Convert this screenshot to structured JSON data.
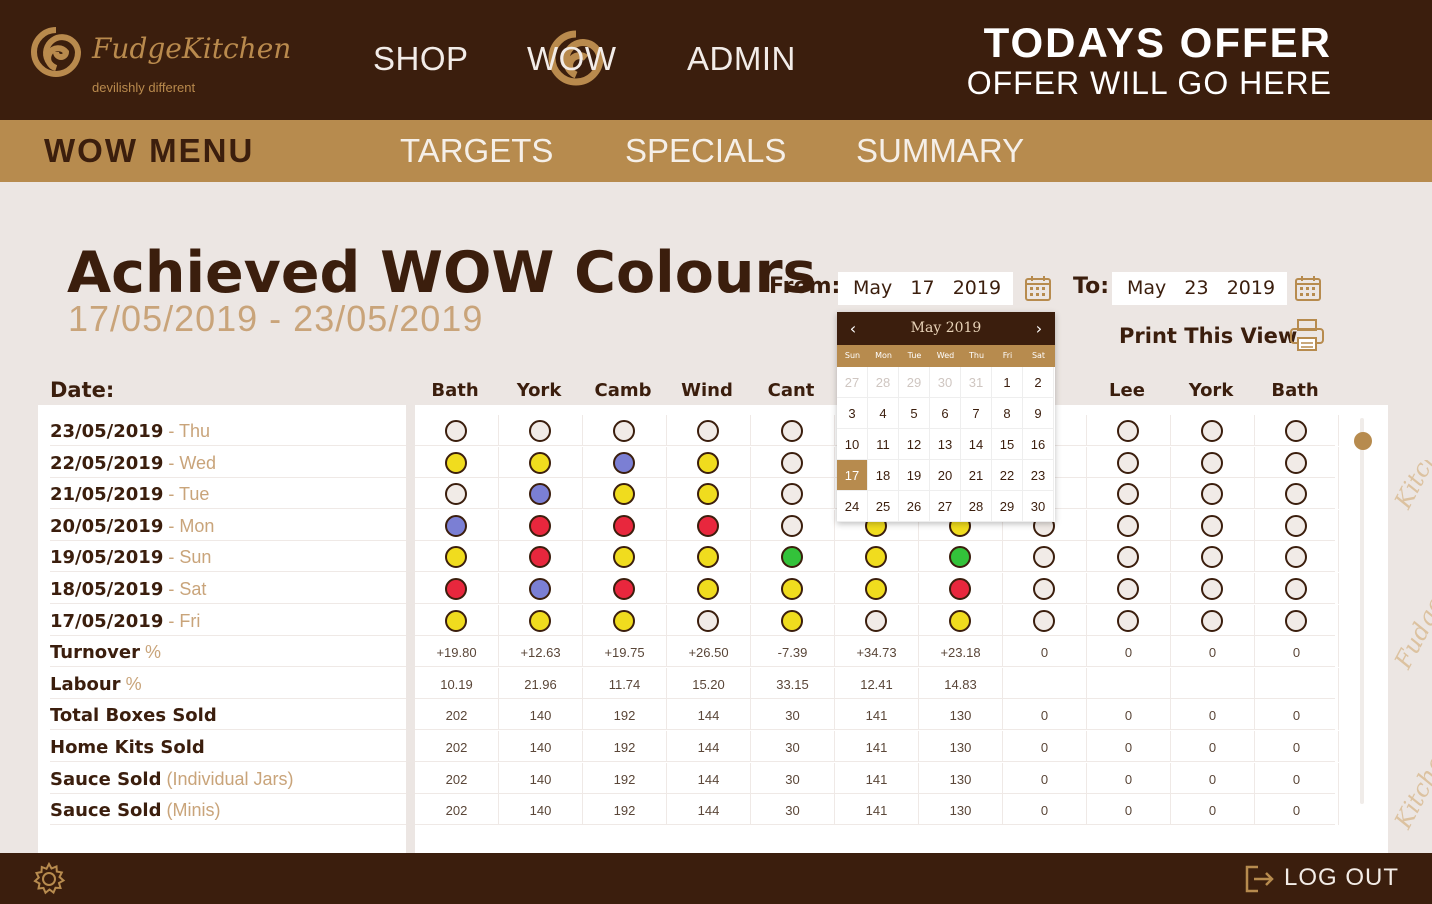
{
  "brand": {
    "name": "FudgeKitchen",
    "tagline": "devilishly different"
  },
  "nav": {
    "shop": "SHOP",
    "wow": "WOW",
    "admin": "ADMIN"
  },
  "offer": {
    "title": "TODAYS OFFER",
    "text": "OFFER WILL GO HERE"
  },
  "subnav": {
    "wow_menu": "WOW MENU",
    "targets": "TARGETS",
    "specials": "SPECIALS",
    "summary": "SUMMARY"
  },
  "page": {
    "title": "Achieved WOW Colours",
    "range": "17/05/2019 - 23/05/2019"
  },
  "filters": {
    "from_label": "From:",
    "from_value": "May   17   2019",
    "to_label": "To:",
    "to_value": "May   23   2019",
    "print_label": "Print This View"
  },
  "calendar": {
    "title": "May 2019",
    "prev": "‹",
    "next": "›",
    "dow": [
      "Sun",
      "Mon",
      "Tue",
      "Wed",
      "Thu",
      "Fri",
      "Sat"
    ],
    "weeks": [
      [
        "27",
        "28",
        "29",
        "30",
        "31",
        "1",
        "2"
      ],
      [
        "3",
        "4",
        "5",
        "6",
        "7",
        "8",
        "9"
      ],
      [
        "10",
        "11",
        "12",
        "13",
        "14",
        "15",
        "16"
      ],
      [
        "17",
        "18",
        "19",
        "20",
        "21",
        "22",
        "23"
      ],
      [
        "24",
        "25",
        "26",
        "27",
        "28",
        "29",
        "30"
      ]
    ],
    "selected": "17"
  },
  "table": {
    "date_header": "Date:",
    "columns": [
      "Bath",
      "York",
      "Camb",
      "Wind",
      "Cant",
      "",
      "",
      "",
      "Lee",
      "York",
      "Bath"
    ],
    "colors": {
      "E": "#f1ebe7",
      "Y": "#f0dc1e",
      "B": "#7b7fd4",
      "R": "#e8273d",
      "G": "#33c23a"
    },
    "date_rows": [
      {
        "date": "23/05/2019",
        "day": " - Thu",
        "dots": [
          "E",
          "E",
          "E",
          "E",
          "E",
          "",
          "",
          "E",
          "E",
          "E",
          "E"
        ]
      },
      {
        "date": "22/05/2019",
        "day": " - Wed",
        "dots": [
          "Y",
          "Y",
          "B",
          "Y",
          "E",
          "",
          "",
          "E",
          "E",
          "E",
          "E"
        ]
      },
      {
        "date": "21/05/2019",
        "day": " - Tue",
        "dots": [
          "E",
          "B",
          "Y",
          "Y",
          "E",
          "",
          "",
          "E",
          "E",
          "E",
          "E"
        ]
      },
      {
        "date": "20/05/2019",
        "day": " - Mon",
        "dots": [
          "B",
          "R",
          "R",
          "R",
          "E",
          "Y",
          "Y",
          "E",
          "E",
          "E",
          "E"
        ]
      },
      {
        "date": "19/05/2019",
        "day": " - Sun",
        "dots": [
          "Y",
          "R",
          "Y",
          "Y",
          "G",
          "Y",
          "G",
          "E",
          "E",
          "E",
          "E"
        ]
      },
      {
        "date": "18/05/2019",
        "day": " - Sat",
        "dots": [
          "R",
          "B",
          "R",
          "Y",
          "Y",
          "Y",
          "R",
          "E",
          "E",
          "E",
          "E"
        ]
      },
      {
        "date": "17/05/2019",
        "day": " - Fri",
        "dots": [
          "Y",
          "Y",
          "Y",
          "E",
          "Y",
          "E",
          "Y",
          "E",
          "E",
          "E",
          "E"
        ]
      }
    ],
    "value_rows": [
      {
        "label": "Turnover",
        "sub": " %",
        "values": [
          "+19.80",
          "+12.63",
          "+19.75",
          "+26.50",
          "-7.39",
          "+34.73",
          "+23.18",
          "0",
          "0",
          "0",
          "0"
        ]
      },
      {
        "label": "Labour",
        "sub": " %",
        "values": [
          "10.19",
          "21.96",
          "11.74",
          "15.20",
          "33.15",
          "12.41",
          "14.83",
          "",
          "",
          "",
          ""
        ]
      },
      {
        "label": "Total Boxes Sold",
        "sub": "",
        "values": [
          "202",
          "140",
          "192",
          "144",
          "30",
          "141",
          "130",
          "0",
          "0",
          "0",
          "0"
        ]
      },
      {
        "label": "Home Kits Sold",
        "sub": "",
        "values": [
          "202",
          "140",
          "192",
          "144",
          "30",
          "141",
          "130",
          "0",
          "0",
          "0",
          "0"
        ]
      },
      {
        "label": "Sauce Sold",
        "sub": " (Individual Jars)",
        "values": [
          "202",
          "140",
          "192",
          "144",
          "30",
          "141",
          "130",
          "0",
          "0",
          "0",
          "0"
        ]
      },
      {
        "label": "Sauce Sold",
        "sub": " (Minis)",
        "values": [
          "202",
          "140",
          "192",
          "144",
          "30",
          "141",
          "130",
          "0",
          "0",
          "0",
          "0"
        ]
      }
    ]
  },
  "footer": {
    "logout": "LOG OUT"
  }
}
